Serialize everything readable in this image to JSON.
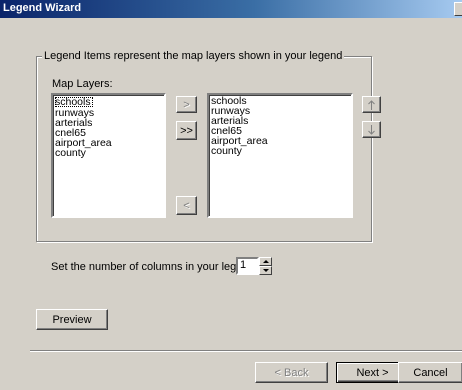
{
  "window": {
    "title": "Legend Wizard"
  },
  "group": {
    "title": "Legend Items represent the map layers shown in your legend",
    "map_layers_label": "Map Layers:",
    "available_layers": [
      "schools",
      "runways",
      "arterials",
      "cnel65",
      "airport_area",
      "county"
    ],
    "legend_items": [
      "schools",
      "runways",
      "arterials",
      "cnel65",
      "airport_area",
      "county"
    ],
    "add_one_label": ">",
    "add_all_label": ">>",
    "remove_label": "<",
    "move_up_icon": "arrow-up-icon",
    "move_down_icon": "arrow-down-icon"
  },
  "columns": {
    "label": "Set the number of columns in your legend:",
    "value": "1"
  },
  "preview_label": "Preview",
  "footer": {
    "back_label": "< Back",
    "next_label": "Next >",
    "cancel_label": "Cancel"
  }
}
